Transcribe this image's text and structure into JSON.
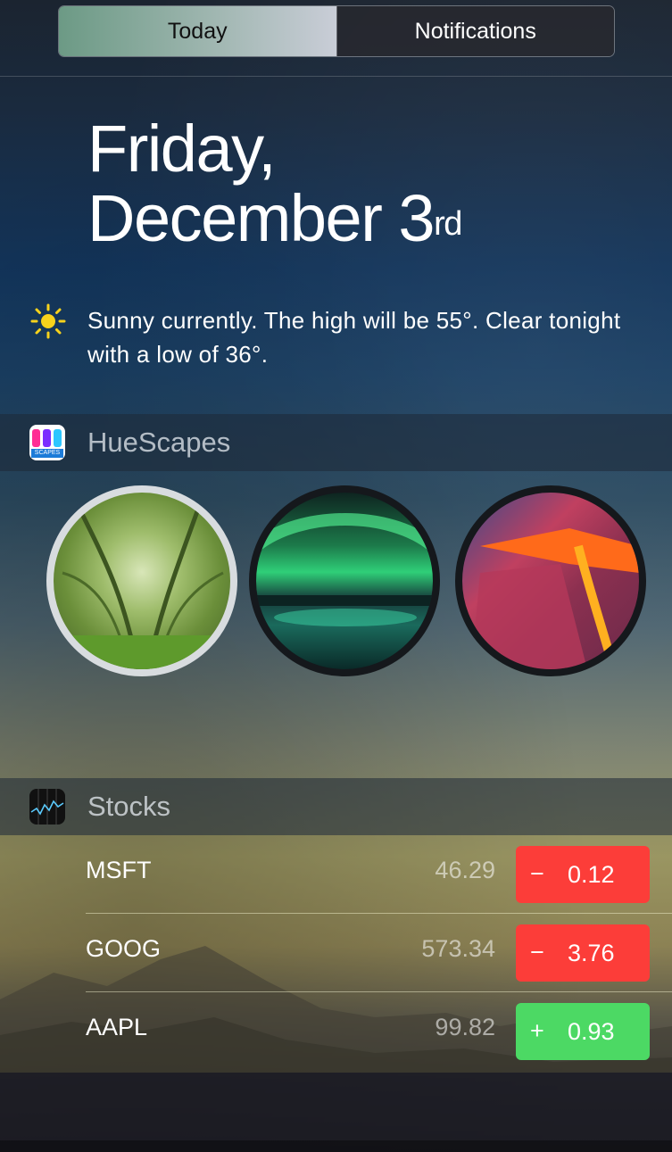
{
  "tabs": [
    {
      "label": "Today",
      "active": true
    },
    {
      "label": "Notifications",
      "active": false
    }
  ],
  "date": {
    "line1": "Friday,",
    "line2": "December 3",
    "suffix": "rd"
  },
  "weather": {
    "icon": "sun-icon",
    "text": "Sunny currently. The high will be 55°. Clear tonight with a low of 36°."
  },
  "huescapes": {
    "title": "HueScapes",
    "icon": "huescapes-app-icon",
    "icon_text": "SCAPES",
    "scenes": [
      {
        "name": "forest-scene",
        "selected": true
      },
      {
        "name": "aurora-scene",
        "selected": false
      },
      {
        "name": "lava-scene",
        "selected": false
      }
    ]
  },
  "stocks": {
    "title": "Stocks",
    "icon": "stocks-app-icon",
    "rows": [
      {
        "symbol": "MSFT",
        "price": "46.29",
        "sign": "−",
        "change": "0.12",
        "color": "#fc3d39"
      },
      {
        "symbol": "GOOG",
        "price": "573.34",
        "sign": "−",
        "change": "3.76",
        "color": "#fc3d39"
      },
      {
        "symbol": "AAPL",
        "price": "99.82",
        "sign": "+",
        "change": "0.93",
        "color": "#4cd964"
      }
    ]
  }
}
